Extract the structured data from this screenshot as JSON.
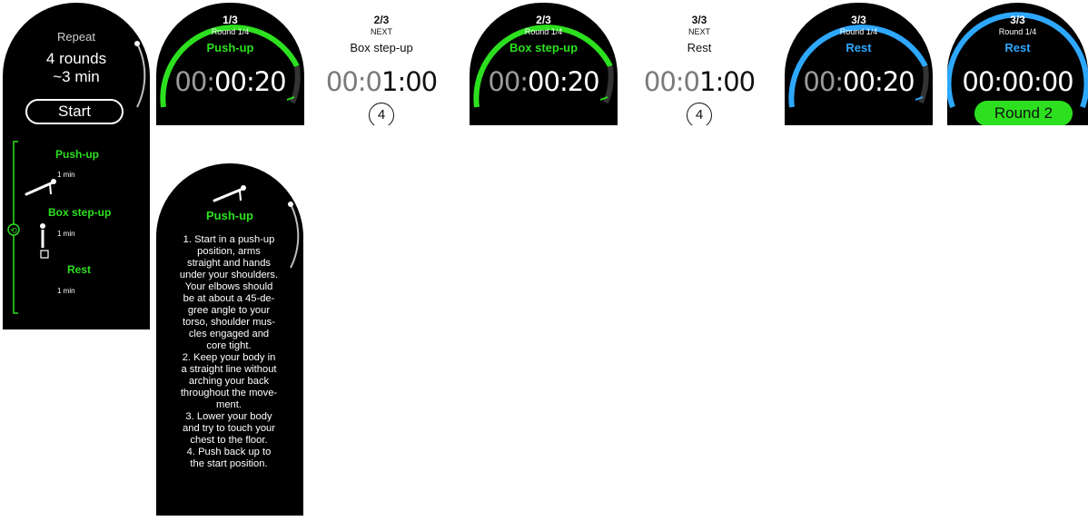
{
  "repeat_screen": {
    "title": "Repeat",
    "rounds": "4 rounds",
    "duration": "~3 min",
    "start_label": "Start",
    "items": [
      {
        "label": "Push-up",
        "duration": "1 min",
        "icon": "pushup-icon"
      },
      {
        "label": "Box step-up",
        "duration": "1 min",
        "icon": "box-stepup-icon"
      },
      {
        "label": "Rest",
        "duration": "1 min",
        "icon": ""
      }
    ],
    "accent": "#2de01f"
  },
  "screens": [
    {
      "counter": "1/3",
      "sub": "Round 1/4",
      "name": "Push-up",
      "time_dim": "00:",
      "time_bright": "00:20",
      "style": "dark-green"
    },
    {
      "counter": "2/3",
      "sub": "NEXT",
      "name": "Box step-up",
      "time_dim": "00:0",
      "time_bright": "1:00",
      "badge": "4",
      "style": "light"
    },
    {
      "counter": "2/3",
      "sub": "Round 1/4",
      "name": "Box step-up",
      "time_dim": "00:",
      "time_bright": "00:20",
      "style": "dark-green"
    },
    {
      "counter": "3/3",
      "sub": "NEXT",
      "name": "Rest",
      "time_dim": "00:0",
      "time_bright": "1:00",
      "badge": "4",
      "style": "light"
    },
    {
      "counter": "3/3",
      "sub": "Round 1/4",
      "name": "Rest",
      "time_dim": "00:",
      "time_bright": "00:20",
      "style": "dark-blue"
    },
    {
      "counter": "3/3",
      "sub": "Round 1/4",
      "name": "Rest",
      "time_dim": "",
      "time_bright": "00:00:00",
      "round_button": "Round 2",
      "style": "dark-blue"
    }
  ],
  "instructions_screen": {
    "title": "Push-up",
    "icon": "pushup-icon",
    "text": "1. Start in a push-up\nposition, arms\nstraight and hands\nunder your shoulders.\nYour elbows should\nbe at about a 45-de-\ngree angle to your\ntorso, shoulder mus-\ncles engaged and\ncore tight.\n2. Keep your body in\na straight line without\narching your back\nthroughout the move-\nment.\n3. Lower your body\nand try to touch your\nchest to the floor.\n4. Push back up to\nthe start position."
  },
  "colors": {
    "green": "#2de01f",
    "blue": "#2ea8ff",
    "background": "#000000"
  }
}
